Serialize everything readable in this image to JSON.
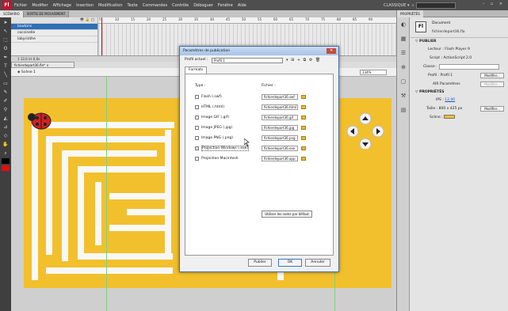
{
  "menubar": {
    "logo": "Fl",
    "items": [
      "Fichier",
      "Modifier",
      "Affichage",
      "Insertion",
      "Modification",
      "Texte",
      "Commandes",
      "Contrôle",
      "Déboguer",
      "Fenêtre",
      "Aide"
    ],
    "workspace": "CLASSIQUE ▾",
    "window_controls": "– ▫ ×"
  },
  "timeline": {
    "tabs": [
      "SCÉNARIO",
      "SORTIE DE MOUVEMENT"
    ],
    "layers": [
      "boutons",
      "coccinelle",
      "labyrinthe"
    ],
    "ruler": [
      "5",
      "10",
      "15",
      "20",
      "25",
      "30",
      "35",
      "40",
      "45",
      "50",
      "55",
      "60",
      "65",
      "70",
      "75",
      "80",
      "85",
      "90",
      "95",
      "100",
      "105"
    ],
    "footer": "1  12,0 i/s  0,0s"
  },
  "document": {
    "tab": "fichierdepart36.fla* ×",
    "scene": "Scène 1",
    "zoom": "134%"
  },
  "dialog": {
    "title": "Paramètres de publication",
    "close": "✕",
    "profile_label": "Profil actuel :",
    "profile_value": "Profil 1",
    "profile_icons": "▾ ⊞ + ⧉ ⚙ 🗑",
    "tab": "Formats",
    "type_header": "Type :",
    "file_header": "Fichier :",
    "types": [
      {
        "label": "Flash (.swf)",
        "checked": false
      },
      {
        "label": "HTML (.html)",
        "checked": false
      },
      {
        "label": "Image GIF (.gif)",
        "checked": false
      },
      {
        "label": "Image JPEG (.jpg)",
        "checked": false
      },
      {
        "label": "Image PNG (.png)",
        "checked": false
      },
      {
        "label": "Projection Windows (.exe)",
        "checked": true
      },
      {
        "label": "Projection Macintosh",
        "checked": false
      }
    ],
    "files": [
      "fichierdepart36.swf",
      "fichierdepart36.html",
      "fichierdepart36.gif",
      "fichierdepart36.jpg",
      "fichierdepart36.png",
      "fichierdepart36.exe",
      "fichierdepart36.app"
    ],
    "default_names": "Utiliser les noms par défaut",
    "buttons": {
      "publish": "Publier",
      "ok": "OK",
      "cancel": "Annuler"
    }
  },
  "properties": {
    "tabs": [
      "PROPRIÉTÉS"
    ],
    "doc_icon": "Fl",
    "doc_type": "Document",
    "doc_file": "fichierdepart36.fla",
    "publish_section": "▽ PUBLIER",
    "player_label": "Lecteur :",
    "player_value": "Flash Player 9",
    "script_label": "Script :",
    "script_value": "ActionScript 2.0",
    "class_label": "Classe :",
    "profile_label": "Profil :",
    "profile_value": "Profil 1",
    "modify": "Modifier...",
    "air_label": "AIR Paramètres",
    "props_section": "▽ PROPRIÉTÉS",
    "fps_label": "IPS :",
    "fps_value": "12,00",
    "size_label": "Taille :",
    "size_value": "800 x 425 px",
    "stage_label": "Scène :",
    "stage_color": "#f2c02d"
  },
  "colors": {
    "stage": "#f2c02d",
    "maze": "#f8f8f8",
    "selection": "#2f6fb6"
  },
  "icons": {
    "toolbar": [
      "arrow-icon",
      "subselect-icon",
      "free-transform-icon",
      "lasso-icon",
      "pen-icon",
      "text-icon",
      "line-icon",
      "rect-icon",
      "pencil-icon",
      "brush-icon",
      "bone-icon",
      "paint-bucket-icon",
      "eyedropper-icon",
      "eraser-icon",
      "hand-icon",
      "zoom-icon"
    ]
  }
}
